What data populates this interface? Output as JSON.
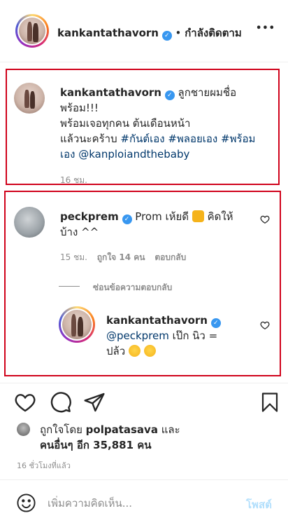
{
  "header": {
    "username": "kankantathavorn",
    "separator": "•",
    "following_label": "กำลังติดตาม",
    "more_label": "•••"
  },
  "caption": {
    "username": "kankantathavorn",
    "line1": "ลูกชายผมชื่อ",
    "line2": "พร้อม!!!",
    "line3": "พร้อมเจอทุกคน ต้นเดือนหน้า",
    "line4_prefix": "แล้วนะคร้าบ",
    "tag1": "#กันต์เอง",
    "tag2": "#พลอยเอง",
    "tag3_part1": "#พร้อม",
    "tag3_part2": "เอง",
    "mention": "@kanploiandthebaby",
    "time": "16 ชม."
  },
  "comment1": {
    "username": "peckprem",
    "text_part1": "Prom เห้ยดี",
    "text_part2": "คิดให้",
    "text_line2": "บ้าง ^^",
    "time": "15 ชม.",
    "likes": "ถูกใจ 14 คน",
    "reply_label": "ตอบกลับ",
    "hide_replies": "ซ่อนข้อความตอบกลับ"
  },
  "reply1": {
    "username": "kankantathavorn",
    "mention": "@peckprem",
    "text_part1": "เป๊ก นิว =",
    "text_line2": "ปล้ว"
  },
  "likes_section": {
    "liked_by_prefix": "ถูกใจโดย",
    "liked_by_user": "polpatasava",
    "and_label": "และ",
    "others": "คนอื่นๆ อีก 35,881 คน",
    "timestamp": "16 ชั่วโมงที่แล้ว"
  },
  "comment_box": {
    "placeholder": "เพิ่มความคิดเห็น...",
    "post_label": "โพสต์"
  },
  "colors": {
    "highlight_border": "#d0021b",
    "verified": "#3897f0",
    "link": "#00376b",
    "post_button": "#b2dffc"
  }
}
